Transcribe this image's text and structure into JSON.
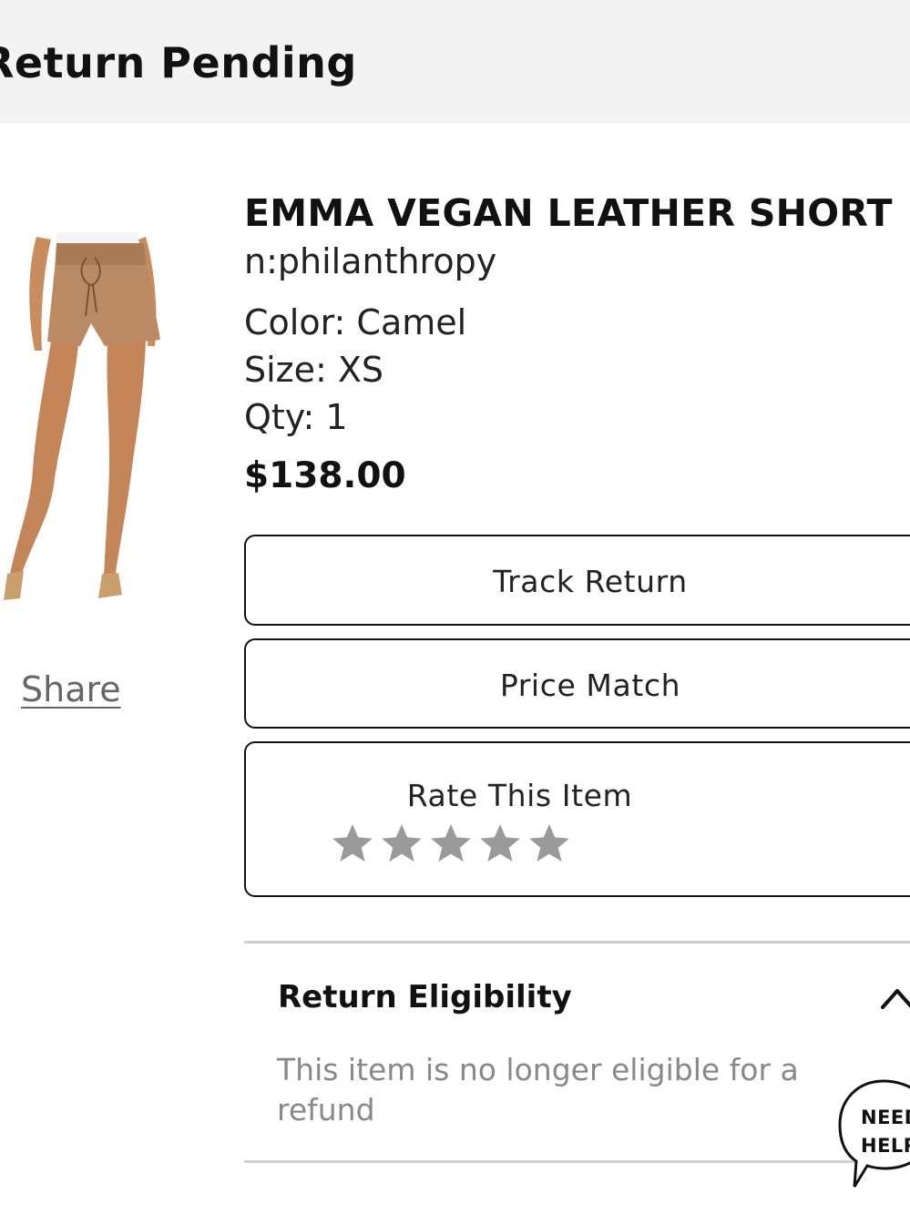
{
  "header": {
    "title": "Return Pending"
  },
  "product": {
    "name": "EMMA VEGAN LEATHER SHORT",
    "brand": "n:philanthropy",
    "color": "Color: Camel",
    "size": "Size: XS",
    "qty": "Qty: 1",
    "price": "$138.00",
    "image_icon": "product-photo-shorts"
  },
  "share": {
    "label": "Share"
  },
  "actions": {
    "track_return": "Track Return",
    "price_match": "Price Match",
    "rate_item": "Rate This Item",
    "rating_value": 0,
    "rating_max": 5
  },
  "eligibility": {
    "title": "Return Eligibility",
    "text": "This item is no longer eligible for a refund",
    "expanded": true
  },
  "help": {
    "line1": "NEED",
    "line2": "HELP"
  },
  "colors": {
    "header_bg": "#f3f3f3",
    "star_color": "#9a9a9a",
    "border": "#111111",
    "muted_text": "#888888"
  }
}
